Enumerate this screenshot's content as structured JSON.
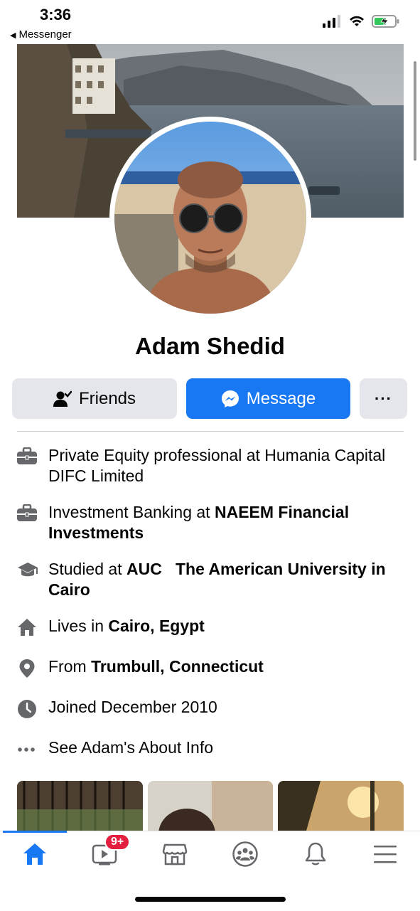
{
  "status_bar": {
    "time": "3:36",
    "back_app": "Messenger"
  },
  "profile": {
    "name": "Adam Shedid"
  },
  "actions": {
    "friends_label": "Friends",
    "message_label": "Message",
    "more_label": "···"
  },
  "intro": {
    "work1": "Private Equity professional at Humania Capital DIFC Limited",
    "work2_prefix": "Investment Banking at ",
    "work2_bold": "NAEEM Financial Investments",
    "edu_prefix": "Studied at ",
    "edu_bold": "AUC   The American University in Cairo",
    "lives_prefix": "Lives in ",
    "lives_bold": "Cairo, Egypt",
    "from_prefix": "From ",
    "from_bold": "Trumbull, Connecticut",
    "joined": "Joined December 2010",
    "see_about": "See Adam's About Info"
  },
  "tabbar": {
    "video_badge": "9+"
  },
  "colors": {
    "accent": "#1877f2",
    "button_gray": "#e4e6eb",
    "icon_gray": "#65676b",
    "badge_red": "#e41e3f"
  }
}
